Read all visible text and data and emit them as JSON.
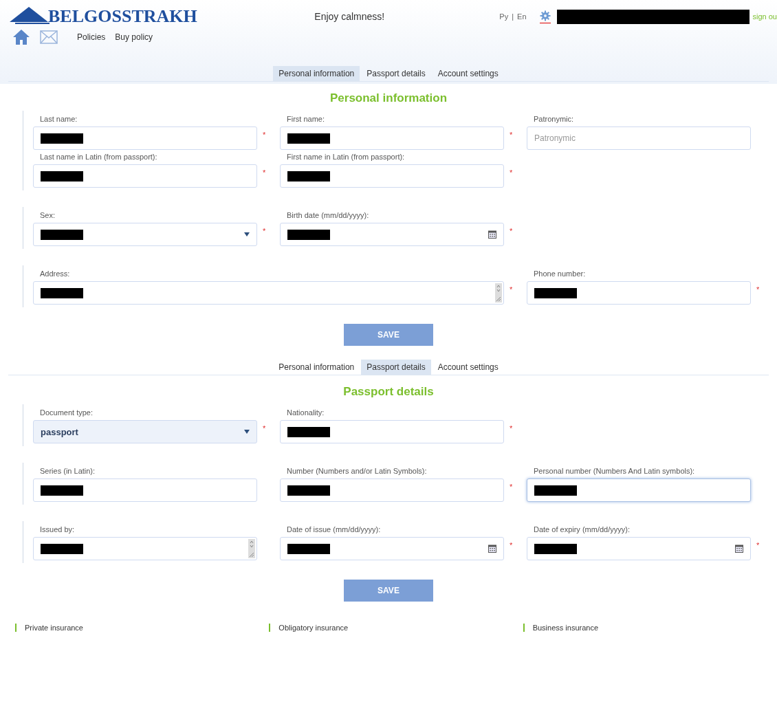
{
  "header": {
    "logo": "BELGOSSTRAKH",
    "slogan": "Enjoy calmness!",
    "languages": [
      "Ру",
      "En"
    ],
    "language_separator": "|",
    "sign_out": "sign ou",
    "nav": [
      "Policies",
      "Buy policy"
    ]
  },
  "sections": [
    {
      "tabs": [
        {
          "label": "Personal information",
          "selected": true
        },
        {
          "label": "Passport details",
          "selected": false
        },
        {
          "label": "Account settings",
          "selected": false
        }
      ],
      "title": "Personal information",
      "groups": [
        {
          "rows": [
            {
              "fields": [
                {
                  "label": "Last name:",
                  "kind": "text",
                  "required": true,
                  "redacted": true
                },
                {
                  "label": "First name:",
                  "kind": "text",
                  "required": true,
                  "redacted": true
                },
                {
                  "label": "Patronymic:",
                  "kind": "text",
                  "required": false,
                  "redacted": false,
                  "placeholder": "Patronymic"
                }
              ]
            },
            {
              "fields": [
                {
                  "label": "Last name in Latin (from passport):",
                  "kind": "text",
                  "required": true,
                  "redacted": true
                },
                {
                  "label": "First name in Latin (from passport):",
                  "kind": "text",
                  "required": true,
                  "redacted": true
                }
              ]
            }
          ]
        },
        {
          "rows": [
            {
              "fields": [
                {
                  "label": "Sex:",
                  "kind": "select",
                  "required": true,
                  "redacted": true
                },
                {
                  "label": "Birth date (mm/dd/yyyy):",
                  "kind": "date",
                  "required": true,
                  "redacted": true
                }
              ]
            }
          ]
        },
        {
          "rows": [
            {
              "fields": [
                {
                  "label": "Address:",
                  "kind": "textarea",
                  "wide": true,
                  "required": true,
                  "redacted": true
                },
                {
                  "label": "Phone number:",
                  "kind": "text",
                  "required": true,
                  "redacted": true
                }
              ]
            }
          ]
        }
      ],
      "button": "SAVE"
    },
    {
      "tabs": [
        {
          "label": "Personal information",
          "selected": false
        },
        {
          "label": "Passport details",
          "selected": true
        },
        {
          "label": "Account settings",
          "selected": false
        }
      ],
      "title": "Passport details",
      "groups": [
        {
          "rows": [
            {
              "fields": [
                {
                  "label": "Document type:",
                  "kind": "select",
                  "required": true,
                  "redacted": false,
                  "value": "passport"
                },
                {
                  "label": "Nationality:",
                  "kind": "text",
                  "required": true,
                  "redacted": true
                }
              ]
            }
          ]
        },
        {
          "rows": [
            {
              "fields": [
                {
                  "label": "Series (in Latin):",
                  "kind": "text",
                  "required": false,
                  "redacted": true
                },
                {
                  "label": "Number (Numbers and/or Latin Symbols):",
                  "kind": "text",
                  "required": true,
                  "redacted": true
                },
                {
                  "label": "Personal number (Numbers And Latin symbols):",
                  "kind": "text",
                  "required": false,
                  "redacted": true,
                  "focused": true
                }
              ]
            }
          ]
        },
        {
          "rows": [
            {
              "fields": [
                {
                  "label": "Issued by:",
                  "kind": "textarea",
                  "required": false,
                  "redacted": true
                },
                {
                  "label": "Date of issue (mm/dd/yyyy):",
                  "kind": "date",
                  "required": true,
                  "redacted": true
                },
                {
                  "label": "Date of expiry (mm/dd/yyyy):",
                  "kind": "date",
                  "required": true,
                  "redacted": true
                }
              ]
            }
          ]
        }
      ],
      "button": "SAVE"
    }
  ],
  "required_mark": "*",
  "footer": [
    "Private insurance",
    "Obligatory insurance",
    "Business insurance"
  ]
}
